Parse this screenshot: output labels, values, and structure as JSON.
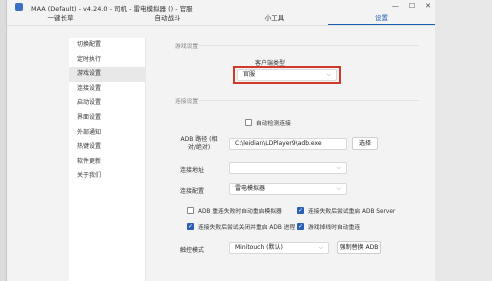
{
  "window": {
    "title": "MAA (Default) - v4.24.0 - 司机 - 雷电模拟器 () - 官服"
  },
  "tabs": [
    {
      "label": "一键长草",
      "active": false
    },
    {
      "label": "自动战斗",
      "active": false
    },
    {
      "label": "小工具",
      "active": false
    },
    {
      "label": "设置",
      "active": true
    }
  ],
  "sidebar": {
    "items": [
      {
        "label": "切换配置"
      },
      {
        "label": "定时执行"
      },
      {
        "label": "游戏设置",
        "active": true
      },
      {
        "label": "连接设置"
      },
      {
        "label": "启动设置"
      },
      {
        "label": "界面设置"
      },
      {
        "label": "外部通知"
      },
      {
        "label": "热键设置"
      },
      {
        "label": "软件更新"
      },
      {
        "label": "关于我们"
      }
    ]
  },
  "game_settings": {
    "section_title": "游戏设置",
    "client_type_label": "客户端类型",
    "client_type_value": "官服"
  },
  "connection": {
    "section_title": "连接设置",
    "auto_detect_label": "自动检测连接",
    "auto_detect_checked": false,
    "adb_path_label": "ADB 路径 (相对/绝对)",
    "adb_path_value": "C:\\leidian\\LDPlayer9\\adb.exe",
    "select_button": "选择",
    "address_label": "连接地址",
    "address_value": "",
    "config_label": "连接配置",
    "config_value": "雷电模拟器",
    "cb1": {
      "label": "ADB 重连失败时自动重启模拟器",
      "checked": false
    },
    "cb2": {
      "label": "连接失败后尝试重启 ADB Server",
      "checked": true
    },
    "cb3": {
      "label": "连接失败后尝试关闭并重启 ADB 进程",
      "checked": true
    },
    "cb4": {
      "label": "游戏掉线时自动重连",
      "checked": true
    },
    "touch_mode_label": "触控模式",
    "touch_mode_value": "Minitouch (默认)",
    "replace_adb_button": "强制替换 ADB"
  },
  "colors": {
    "accent": "#2b5fb4",
    "highlight_frame": "#d03a2a"
  }
}
